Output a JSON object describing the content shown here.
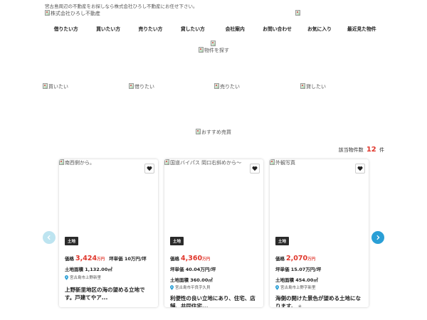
{
  "header": {
    "tagline": "宮古島周辺の不動産をお探しなら株式会社ひろし不動産にお任せ下さい。",
    "logo_alt": "株式会社ひろし不動産",
    "top_right_alt": ""
  },
  "nav": {
    "items": [
      {
        "label": "借りたい方"
      },
      {
        "label": "買いたい方"
      },
      {
        "label": "売りたい方"
      },
      {
        "label": "貸したい方"
      },
      {
        "label": "会社案内"
      },
      {
        "label": "お問い合わせ"
      },
      {
        "label": "お気に入り"
      },
      {
        "label": "最近見た物件"
      }
    ]
  },
  "hero": {
    "img1_alt": "",
    "search_alt": "物件を探す"
  },
  "categories": [
    {
      "alt": "買いたい"
    },
    {
      "alt": "借りたい"
    },
    {
      "alt": "売りたい"
    },
    {
      "alt": "貸したい"
    }
  ],
  "recommend": {
    "alt": "おすすめ売買",
    "count_prefix": "該当物件数",
    "count": "12",
    "count_suffix": "件"
  },
  "colors": {
    "accent_red": "#e0362b",
    "arrow_active": "#2a9fd6",
    "arrow_inactive": "#bde4f0"
  },
  "cards": [
    {
      "photo_alt": "南西側から。",
      "tag": "土地",
      "price_label": "価格",
      "price_amount": "3,424",
      "price_unit": "万円",
      "tsubo": "坪単価 10万円/坪",
      "line2": "土地面積 1,132.00㎡",
      "location": "宮古島市上野新里",
      "description": "上野新里地区の海の望める立地です。戸建てやア...",
      "more": ""
    },
    {
      "photo_alt": "国道バイパス 岡口右斜めから～",
      "tag": "土地",
      "price_label": "価格",
      "price_amount": "4,360",
      "price_unit": "万円",
      "tsubo": "",
      "line2": "坪単価 40.04万円/坪",
      "line3": "土地面積 360.00㎡",
      "location": "宮古島市平良字久貝",
      "description": "利便性の良い立地にあり、住宅、店舗、共同住宅...",
      "more": ""
    },
    {
      "photo_alt": "外観写真",
      "tag": "土地",
      "price_label": "価格",
      "price_amount": "2,070",
      "price_unit": "万円",
      "tsubo": "",
      "line2": "坪単価 15.07万円/坪",
      "line3": "土地面積 454.00㎡",
      "location": "宮古島市上野字新里",
      "description": "海側の開けた景色が望める土地になります。",
      "more": "※..."
    }
  ]
}
